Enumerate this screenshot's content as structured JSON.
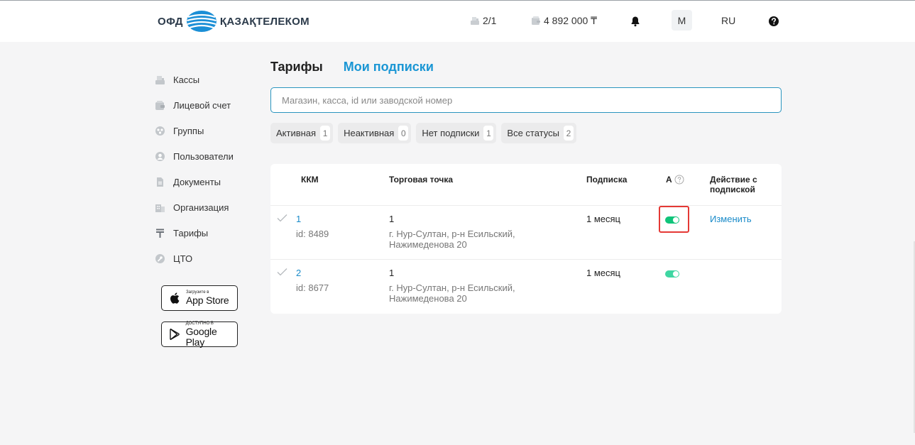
{
  "header": {
    "logo_left": "ОФД",
    "logo_right": "ҚАЗАҚТЕЛЕКОМ",
    "kkm_count": "2/1",
    "balance": "4 892 000 ₸",
    "user_initial": "М",
    "language": "RU"
  },
  "sidebar": {
    "items": [
      {
        "label": "Кассы",
        "icon": "cash-register-icon"
      },
      {
        "label": "Лицевой счет",
        "icon": "wallet-icon"
      },
      {
        "label": "Группы",
        "icon": "groups-icon"
      },
      {
        "label": "Пользователи",
        "icon": "user-icon"
      },
      {
        "label": "Документы",
        "icon": "document-icon"
      },
      {
        "label": "Организация",
        "icon": "building-icon"
      },
      {
        "label": "Тарифы",
        "icon": "tenge-icon"
      },
      {
        "label": "ЦТО",
        "icon": "wrench-icon"
      }
    ],
    "appstore_small": "Загрузите в",
    "appstore_big": "App Store",
    "gplay_small": "ДОСТУПНО В",
    "gplay_big": "Google Play"
  },
  "tabs": {
    "tariffs": "Тарифы",
    "subscriptions": "Мои подписки"
  },
  "search": {
    "placeholder": "Магазин, касса, id или заводской номер"
  },
  "filters": [
    {
      "label": "Активная",
      "count": "1"
    },
    {
      "label": "Неактивная",
      "count": "0"
    },
    {
      "label": "Нет подписки",
      "count": "1"
    },
    {
      "label": "Все статусы",
      "count": "2"
    }
  ],
  "table": {
    "headers": {
      "kkm": "ККМ",
      "point": "Торговая точка",
      "subscription": "Подписка",
      "auto": "А",
      "action": "Действие с подпиской"
    },
    "rows": [
      {
        "kkm_number": "1",
        "kkm_id": "id: 8489",
        "point_name": "1",
        "point_address": "г. Нур-Султан, р-н Есильский, Нажимеденова 20",
        "subscription": "1 месяц",
        "auto_renew": true,
        "action": "Изменить"
      },
      {
        "kkm_number": "2",
        "kkm_id": "id: 8677",
        "point_name": "1",
        "point_address": "г. Нур-Султан, р-н Есильский, Нажимеденова 20",
        "subscription": "1 месяц",
        "auto_renew": true,
        "action": ""
      }
    ]
  },
  "colors": {
    "accent": "#1a96d4",
    "toggle_on": "#10c47a",
    "highlight": "#e53935"
  }
}
